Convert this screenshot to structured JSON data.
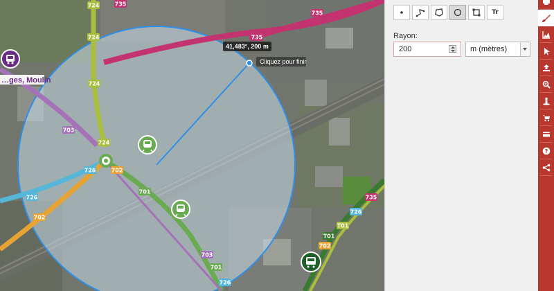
{
  "map": {
    "routes": [
      "735",
      "735",
      "735",
      "735",
      "724",
      "724",
      "724",
      "724",
      "703",
      "703",
      "726",
      "726",
      "702",
      "702",
      "701",
      "701",
      "726",
      "702",
      "T01",
      "T01",
      "726"
    ],
    "stop_label": "…ges, Moulin",
    "tooltip": {
      "text": "41,483°, 200 m",
      "hint": "Cliquez pour finir"
    },
    "icons": {
      "bus_stop_purple": "bus-icon",
      "station_green": "train-icon",
      "station_dark": "bus-icon"
    },
    "colors": {
      "route_735": "#c2336f",
      "route_724": "#a9be3c",
      "route_703": "#a472b6",
      "route_726": "#56b6d8",
      "route_702": "#e7a434",
      "route_701": "#6aaa50",
      "circle_stroke": "#2f8fe8",
      "circle_fill": "#c9dcea"
    }
  },
  "panel": {
    "tools": [
      {
        "name": "point-tool",
        "icon": "point-icon"
      },
      {
        "name": "line-tool",
        "icon": "line-icon"
      },
      {
        "name": "polygon-tool",
        "icon": "polygon-icon"
      },
      {
        "name": "circle-tool",
        "icon": "circle-icon",
        "active": true
      },
      {
        "name": "rectangle-tool",
        "icon": "rectangle-icon"
      },
      {
        "name": "text-tool",
        "icon": "text-icon",
        "glyph": "Tr"
      }
    ],
    "radius_label": "Rayon:",
    "radius_value": "200",
    "unit_value": "m (mètres)"
  },
  "sidebar": {
    "items": [
      {
        "name": "print",
        "icon": "print-icon"
      },
      {
        "name": "draw",
        "icon": "brush-icon",
        "active": true
      },
      {
        "name": "elevation",
        "icon": "chart-icon"
      },
      {
        "name": "measure",
        "icon": "cursor-icon"
      },
      {
        "name": "import",
        "icon": "upload-icon"
      },
      {
        "name": "search",
        "icon": "zoom-icon"
      },
      {
        "name": "street-view",
        "icon": "person-icon"
      },
      {
        "name": "shop",
        "icon": "cart-icon"
      },
      {
        "name": "card",
        "icon": "card-icon"
      },
      {
        "name": "help",
        "icon": "help-icon"
      },
      {
        "name": "share",
        "icon": "share-icon"
      }
    ],
    "accent": "#b8372e"
  }
}
